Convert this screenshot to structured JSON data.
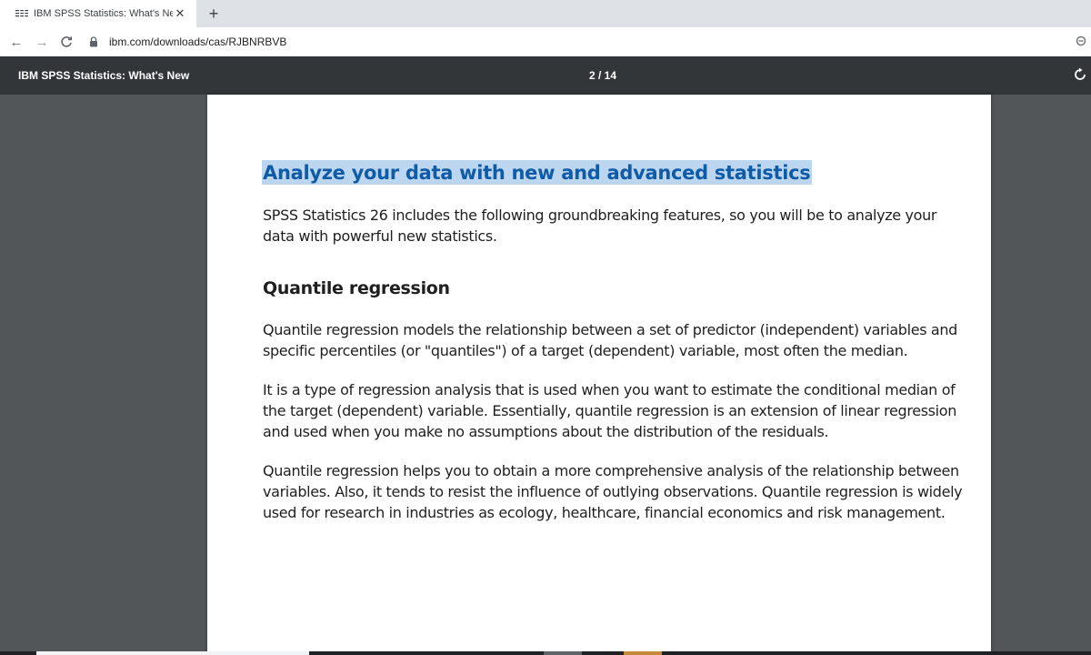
{
  "browser": {
    "tab": {
      "title": "IBM SPSS Statistics: What's New",
      "favicon": "ibm-logo-icon",
      "close_glyph": "✕"
    },
    "new_tab_glyph": "+",
    "nav": {
      "back_glyph": "←",
      "forward_glyph": "→",
      "reload_glyph": "C"
    },
    "url": "ibm.com/downloads/cas/RJBNRBVB"
  },
  "pdf_viewer": {
    "title": "IBM SPSS Statistics: What's New",
    "page_indicator": "2 / 14",
    "rotate_icon": "rotate-icon"
  },
  "document": {
    "heading": "Analyze your data with new and advanced statistics",
    "intro": "SPSS Statistics 26 includes the following groundbreaking features, so you will be to analyze your data with powerful new statistics.",
    "subheading": "Quantile regression",
    "paragraphs": [
      "Quantile regression models the relationship between a set of predictor (independent) variables and specific percentiles (or \"quantiles\") of a target (dependent) variable, most often the median.",
      "It is a type of regression analysis that is used when you want to estimate the conditional median of the target (dependent) variable. Essentially, quantile regression is an extension of linear regression and used when you make no assumptions about the distribution of the residuals.",
      "Quantile regression helps you to obtain a more comprehensive analysis of the relationship between variables. Also, it tends to resist the influence of outlying observations. Quantile regression is widely used for research in industries as ecology, healthcare, financial economics and risk management."
    ]
  },
  "colors": {
    "heading": "#0f5ba7",
    "highlight": "#bcd6ef",
    "viewer_bg": "#525659",
    "pdf_toolbar": "#323639"
  }
}
